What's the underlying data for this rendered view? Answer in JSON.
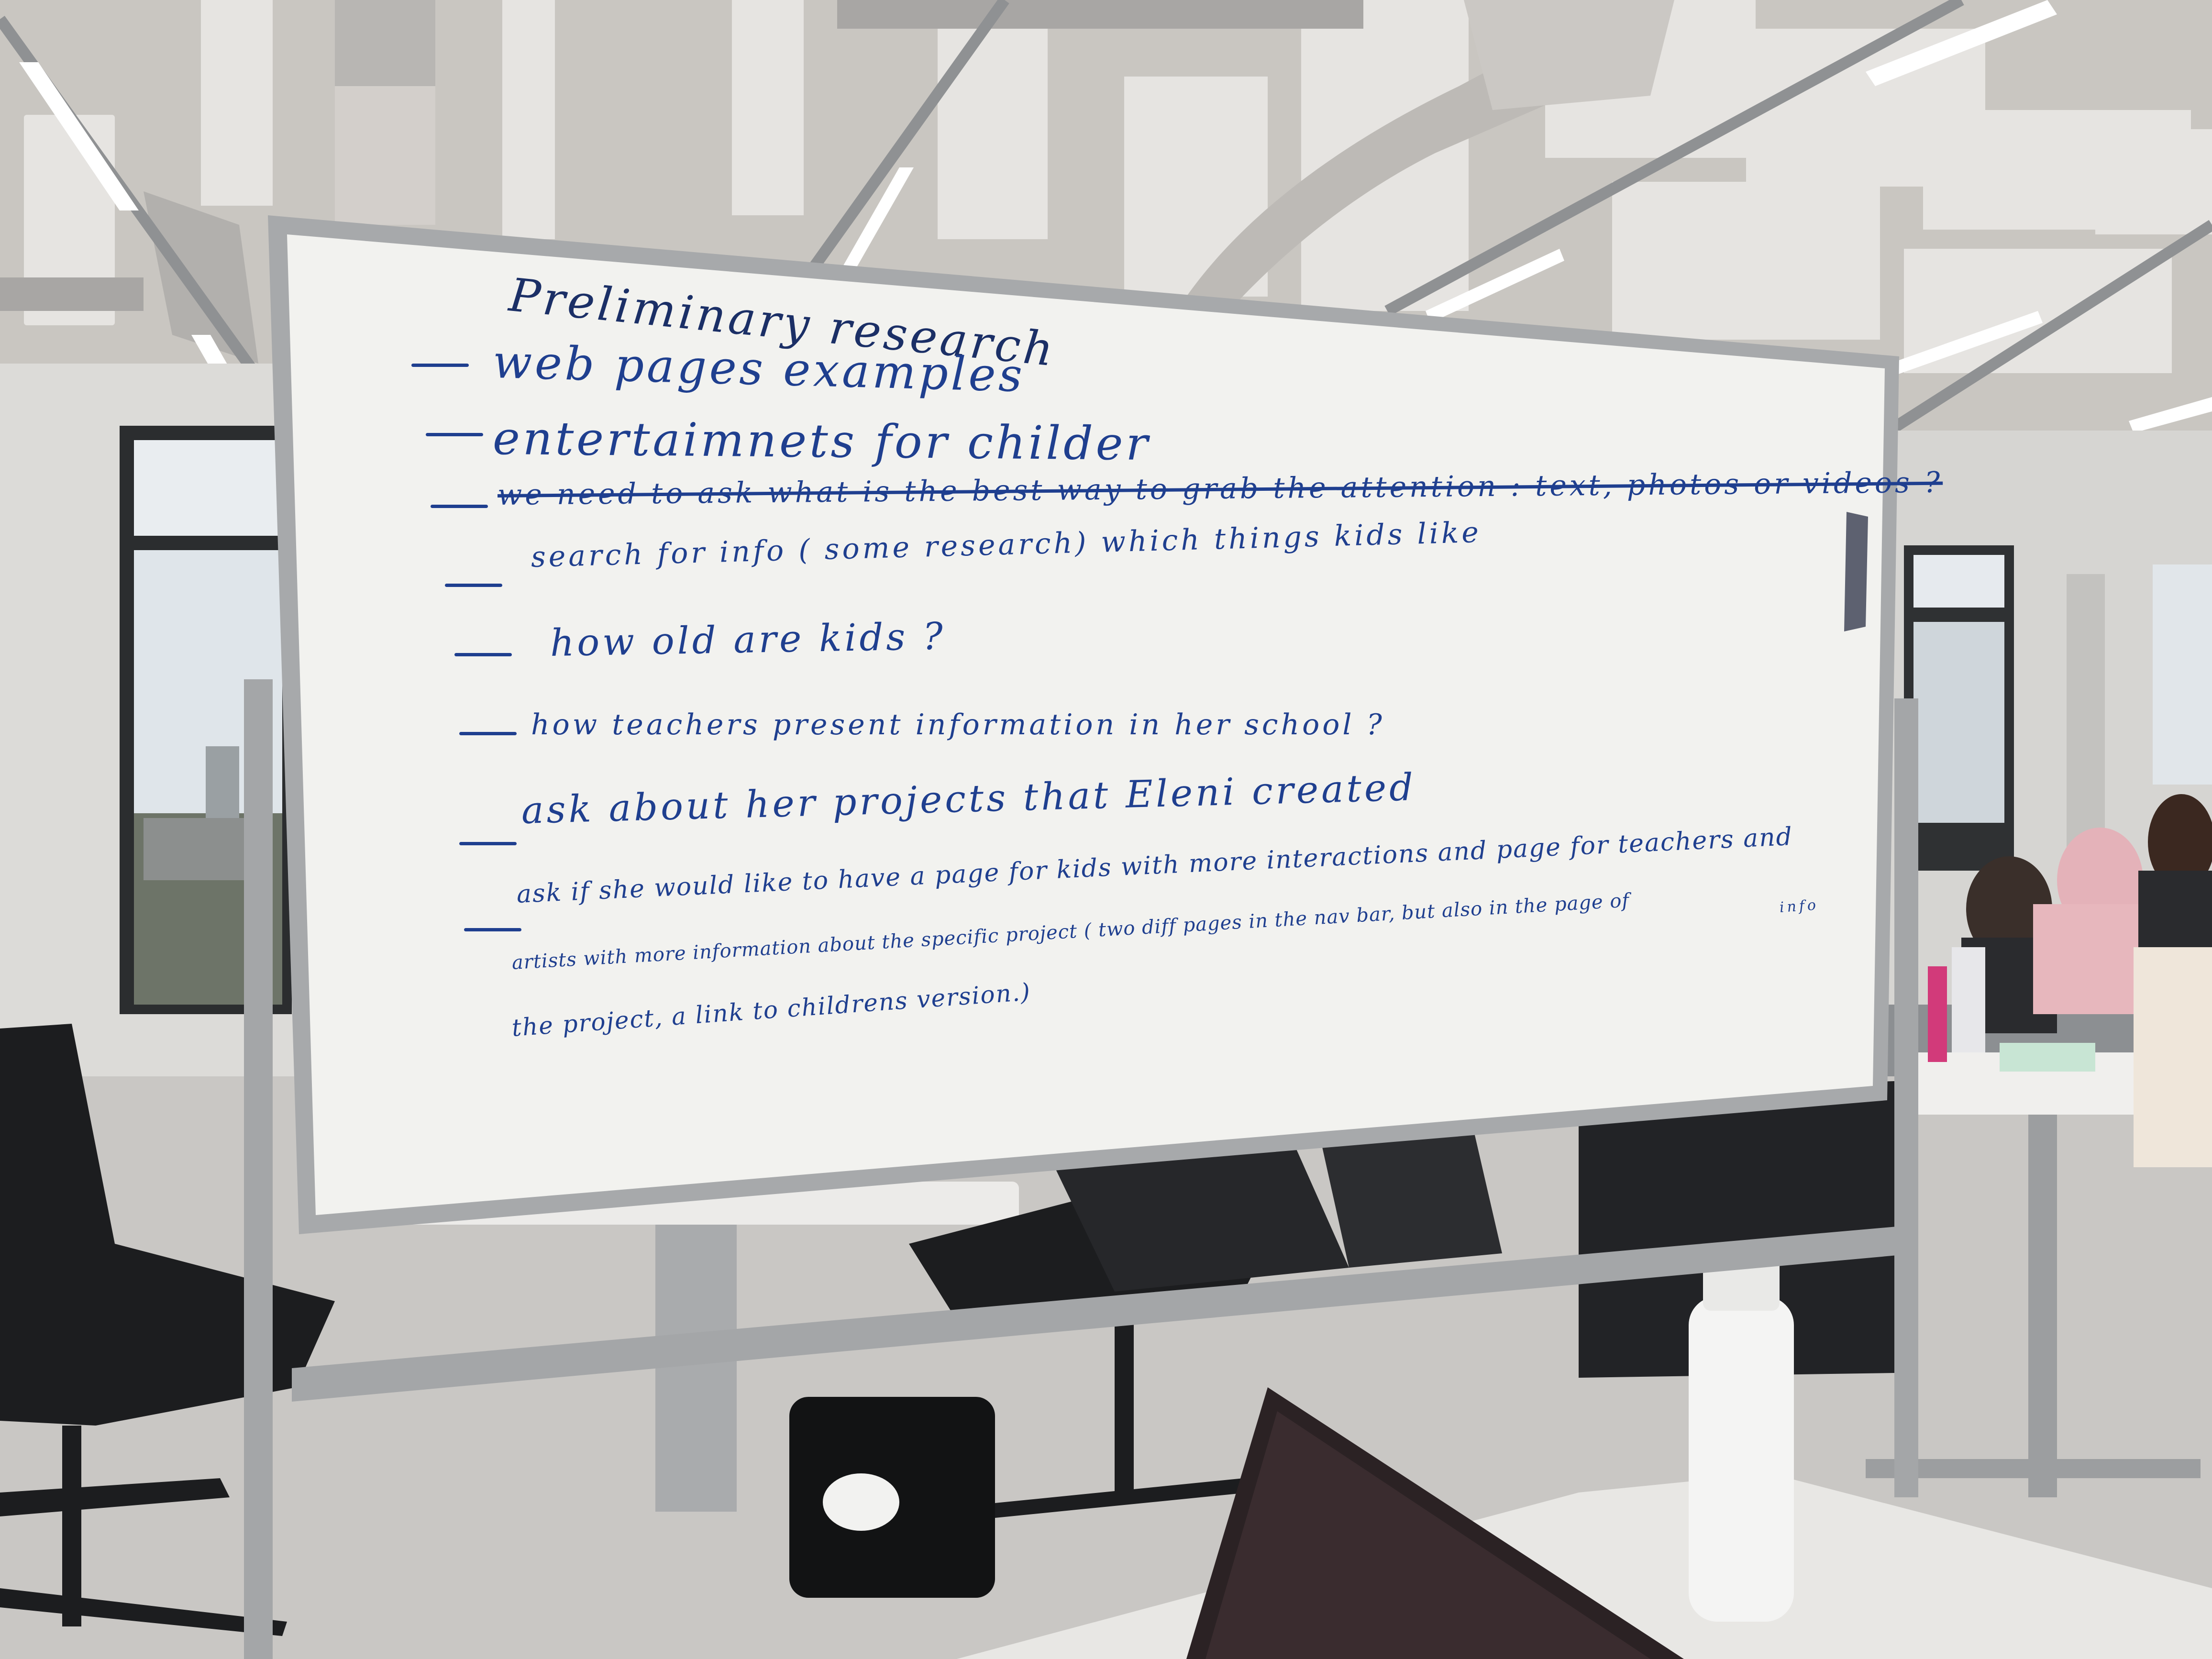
{
  "whiteboard": {
    "title": "Preliminary research",
    "lines": [
      {
        "text": "web pages examples"
      },
      {
        "text": "entertaimnets for childer"
      },
      {
        "text": "we need to ask what is the best way to grab the attention : text, photos or videos ?"
      },
      {
        "text": "search for info ( some research) which things kids like"
      },
      {
        "text": "how old are kids ?"
      },
      {
        "text": "how teachers present information in her school ?"
      },
      {
        "text": "ask about her projects that Eleni created"
      },
      {
        "text": "ask if she would like to have a page for kids with more interactions and page for teachers and"
      },
      {
        "text": "artists with more information about the specific project ( two diff pages in the nav bar, but also in the page of"
      },
      {
        "text": "the project, a link to childrens version.)"
      }
    ],
    "annotation": "info"
  },
  "colors": {
    "marker": "#1f3f8f",
    "board": "#f1f1ee",
    "frame": "#9a9c9e",
    "ceiling": "#cfcdc8"
  }
}
